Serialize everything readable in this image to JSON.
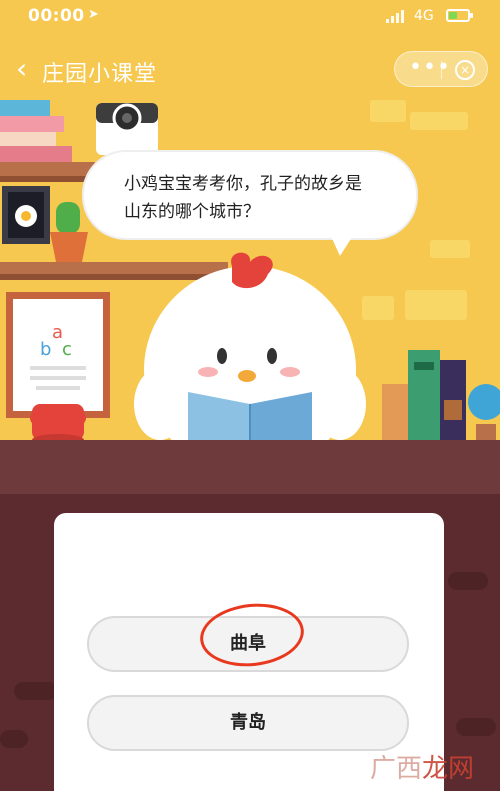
{
  "status_bar": {
    "time": "00:00",
    "network": "4G"
  },
  "nav": {
    "title": "庄园小课堂",
    "more_glyph": "•••",
    "close_glyph": "⊗"
  },
  "question": {
    "text": "小鸡宝宝考考你，孔子的故乡是山东的哪个城市？"
  },
  "options": [
    {
      "label": "曲阜",
      "marked": true
    },
    {
      "label": "青岛",
      "marked": false
    }
  ],
  "watermark": {
    "part1": "广西",
    "part2": "龙网"
  },
  "colors": {
    "scene_bg": "#f6c84f",
    "floor_bg": "#5b2b2f",
    "mark_red": "#e8391f"
  }
}
